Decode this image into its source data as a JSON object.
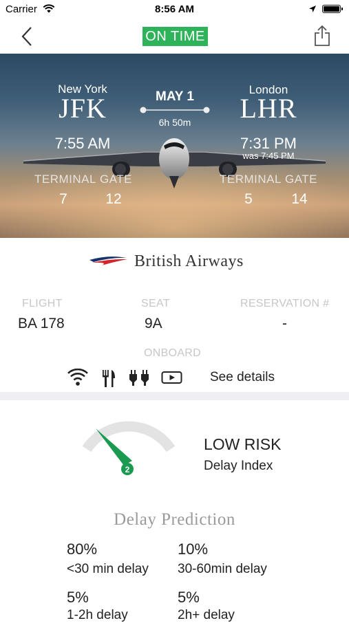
{
  "status_bar": {
    "carrier": "Carrier",
    "time": "8:56 AM"
  },
  "header": {
    "status_badge": "ON TIME",
    "badge_color": "#2fb35a"
  },
  "flight_route": {
    "date": "MAY 1",
    "duration": "6h 50m",
    "origin": {
      "city": "New York",
      "code": "JFK",
      "time": "7:55 AM",
      "terminal_label": "TERMINAL",
      "gate_label": "GATE",
      "terminal": "7",
      "gate": "12"
    },
    "destination": {
      "city": "London",
      "code": "LHR",
      "time": "7:31 PM",
      "was_time": "was 7:45 PM",
      "terminal_label": "TERMINAL",
      "gate_label": "GATE",
      "terminal": "5",
      "gate": "14"
    }
  },
  "airline": {
    "name": "British Airways"
  },
  "flight_info": {
    "flight_label": "FLIGHT",
    "flight_value": "BA 178",
    "seat_label": "SEAT",
    "seat_value": "9A",
    "reservation_label": "RESERVATION #",
    "reservation_value": "-"
  },
  "onboard": {
    "label": "ONBOARD",
    "amenities": [
      "wifi-icon",
      "meal-icon",
      "power-icon",
      "video-icon"
    ],
    "details_link": "See details"
  },
  "delay": {
    "gauge_value": "2",
    "risk_level": "LOW RISK",
    "risk_sublabel": "Delay Index",
    "needle_color": "#1a9a50"
  },
  "prediction": {
    "title": "Delay Prediction",
    "items": [
      {
        "percent": "80%",
        "label": "<30 min delay"
      },
      {
        "percent": "10%",
        "label": "30-60min delay"
      },
      {
        "percent": "5%",
        "label": "1-2h delay"
      },
      {
        "percent": "5%",
        "label": "2h+ delay"
      }
    ]
  }
}
